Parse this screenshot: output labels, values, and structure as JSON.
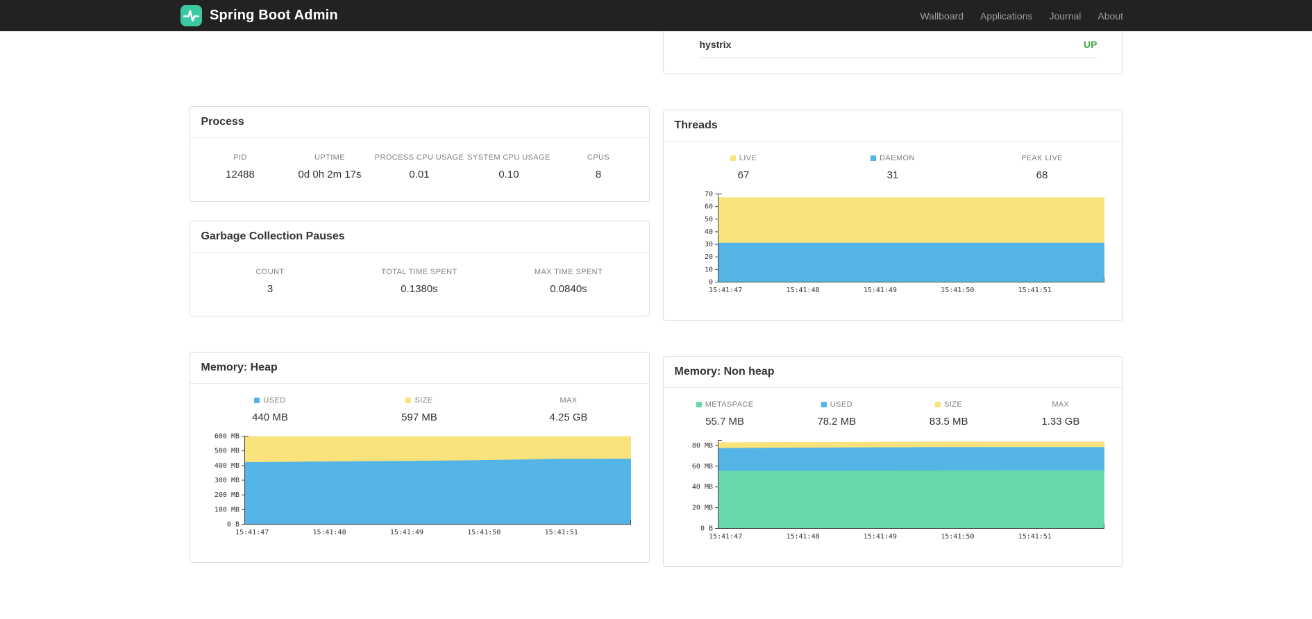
{
  "colors": {
    "navbar_bg": "#222222",
    "logo": "#3bc8a3",
    "blue": "#54b4e6",
    "yellow": "#fae27c",
    "green": "#67d9a8",
    "status_up": "#47a447"
  },
  "navbar": {
    "brand": "Spring Boot Admin",
    "items": [
      "Wallboard",
      "Applications",
      "Journal",
      "About"
    ]
  },
  "health": {
    "name": "hystrix",
    "status": "UP"
  },
  "process": {
    "title": "Process",
    "stats": [
      {
        "label": "PID",
        "value": "12488"
      },
      {
        "label": "UPTIME",
        "value": "0d 0h 2m 17s"
      },
      {
        "label": "PROCESS CPU USAGE",
        "value": "0.01"
      },
      {
        "label": "SYSTEM CPU USAGE",
        "value": "0.10"
      },
      {
        "label": "CPUS",
        "value": "8"
      }
    ]
  },
  "gc": {
    "title": "Garbage Collection Pauses",
    "stats": [
      {
        "label": "COUNT",
        "value": "3"
      },
      {
        "label": "TOTAL TIME SPENT",
        "value": "0.1380s"
      },
      {
        "label": "MAX TIME SPENT",
        "value": "0.0840s"
      }
    ]
  },
  "threads": {
    "title": "Threads",
    "stats": [
      {
        "label": "LIVE",
        "value": "67",
        "swatch": "#fae27c"
      },
      {
        "label": "DAEMON",
        "value": "31",
        "swatch": "#54b4e6"
      },
      {
        "label": "PEAK LIVE",
        "value": "68"
      }
    ]
  },
  "heap": {
    "title": "Memory: Heap",
    "stats": [
      {
        "label": "USED",
        "value": "440 MB",
        "swatch": "#54b4e6"
      },
      {
        "label": "SIZE",
        "value": "597 MB",
        "swatch": "#fae27c"
      },
      {
        "label": "MAX",
        "value": "4.25 GB"
      }
    ]
  },
  "nonheap": {
    "title": "Memory: Non heap",
    "stats": [
      {
        "label": "METASPACE",
        "value": "55.7 MB",
        "swatch": "#67d9a8"
      },
      {
        "label": "USED",
        "value": "78.2 MB",
        "swatch": "#54b4e6"
      },
      {
        "label": "SIZE",
        "value": "83.5 MB",
        "swatch": "#fae27c"
      },
      {
        "label": "MAX",
        "value": "1.33 GB"
      }
    ]
  },
  "chart_data": [
    {
      "type": "area",
      "title": "Threads",
      "legend_position": "top",
      "grid": false,
      "x_labels": [
        "15:41:47",
        "15:41:48",
        "15:41:49",
        "15:41:50",
        "15:41:51"
      ],
      "ylim": [
        0,
        70
      ],
      "yticks": [
        {
          "v": 0,
          "label": "0"
        },
        {
          "v": 10,
          "label": "10"
        },
        {
          "v": 20,
          "label": "20"
        },
        {
          "v": 30,
          "label": "30"
        },
        {
          "v": 40,
          "label": "40"
        },
        {
          "v": 50,
          "label": "50"
        },
        {
          "v": 60,
          "label": "60"
        },
        {
          "v": 70,
          "label": "70"
        }
      ],
      "series": [
        {
          "name": "LIVE",
          "color": "#fae27c",
          "values": [
            67,
            67,
            67,
            67,
            67,
            67
          ]
        },
        {
          "name": "DAEMON",
          "color": "#54b4e6",
          "values": [
            31,
            31,
            31,
            31,
            31,
            31
          ]
        }
      ],
      "current": {
        "LIVE": 67,
        "DAEMON": 31,
        "PEAK LIVE": 68
      }
    },
    {
      "type": "area",
      "title": "Memory: Heap (MB)",
      "legend_position": "top",
      "grid": false,
      "x_labels": [
        "15:41:47",
        "15:41:48",
        "15:41:49",
        "15:41:50",
        "15:41:51"
      ],
      "ylim": [
        0,
        600
      ],
      "yticks": [
        {
          "v": 0,
          "label": "0 B"
        },
        {
          "v": 100,
          "label": "100 MB"
        },
        {
          "v": 200,
          "label": "200 MB"
        },
        {
          "v": 300,
          "label": "300 MB"
        },
        {
          "v": 400,
          "label": "400 MB"
        },
        {
          "v": 500,
          "label": "500 MB"
        },
        {
          "v": 600,
          "label": "600 MB"
        }
      ],
      "series": [
        {
          "name": "SIZE",
          "color": "#fae27c",
          "values": [
            597,
            597,
            597,
            597,
            597,
            597
          ]
        },
        {
          "name": "USED",
          "color": "#54b4e6",
          "values": [
            420,
            425,
            429,
            433,
            443,
            444
          ]
        }
      ],
      "current": {
        "USED": "440 MB",
        "SIZE": "597 MB",
        "MAX": "4.25 GB"
      }
    },
    {
      "type": "area",
      "title": "Memory: Non heap (MB)",
      "legend_position": "top",
      "grid": false,
      "x_labels": [
        "15:41:47",
        "15:41:48",
        "15:41:49",
        "15:41:50",
        "15:41:51"
      ],
      "ylim": [
        0,
        85
      ],
      "yticks": [
        {
          "v": 0,
          "label": "0 B"
        },
        {
          "v": 20,
          "label": "20 MB"
        },
        {
          "v": 40,
          "label": "40 MB"
        },
        {
          "v": 60,
          "label": "60 MB"
        },
        {
          "v": 80,
          "label": "80 MB"
        }
      ],
      "series": [
        {
          "name": "SIZE",
          "color": "#fae27c",
          "values": [
            82.7,
            83.0,
            83.2,
            83.4,
            83.5,
            83.5
          ]
        },
        {
          "name": "USED",
          "color": "#54b4e6",
          "values": [
            77.2,
            77.6,
            77.9,
            78.1,
            78.2,
            78.2
          ]
        },
        {
          "name": "METASPACE",
          "color": "#67d9a8",
          "values": [
            55.0,
            55.2,
            55.4,
            55.6,
            55.7,
            55.7
          ]
        }
      ],
      "current": {
        "METASPACE": "55.7 MB",
        "USED": "78.2 MB",
        "SIZE": "83.5 MB",
        "MAX": "1.33 GB"
      }
    }
  ]
}
